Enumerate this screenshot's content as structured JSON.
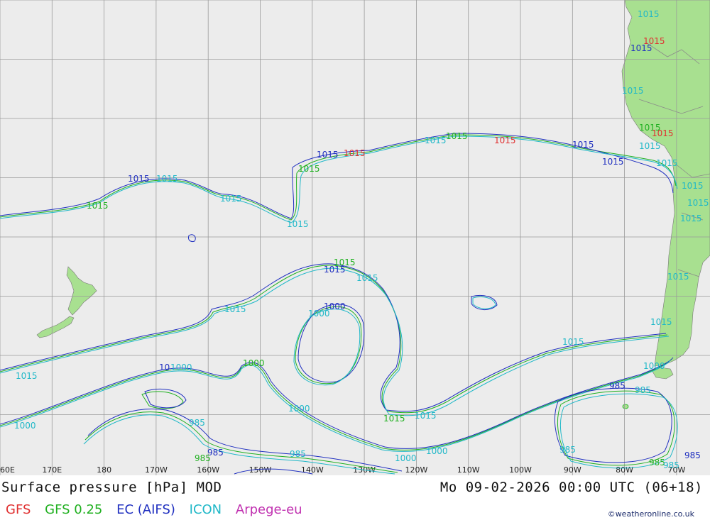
{
  "map": {
    "lon_labels": [
      "60E",
      "170E",
      "180",
      "170W",
      "160W",
      "150W",
      "140W",
      "130W",
      "120W",
      "110W",
      "100W",
      "90W",
      "80W",
      "70W"
    ],
    "isobar_labels": {
      "p1015": "1015",
      "p1000": "1000",
      "p985": "985",
      "p1005": "1005",
      "p100": "10"
    }
  },
  "footer": {
    "title": "Surface pressure [hPa] MOD",
    "datetime": "Mo 09-02-2026 00:00 UTC (06+18)",
    "models": [
      {
        "name": "GFS",
        "color": "#e03030"
      },
      {
        "name": "GFS 0.25",
        "color": "#20b020"
      },
      {
        "name": "EC (AIFS)",
        "color": "#2030c0"
      },
      {
        "name": "ICON",
        "color": "#20b8c8"
      },
      {
        "name": "Arpege-eu",
        "color": "#c030b0"
      }
    ],
    "credit": "©weatheronline.co.uk"
  },
  "colors": {
    "ocean": "#ececec",
    "land": "#a8e090",
    "grid": "#9a9a9a",
    "gfs": "#e03030",
    "gfs025": "#20b020",
    "ec": "#2030c0",
    "icon": "#20b8c8",
    "arpege": "#c030b0"
  }
}
